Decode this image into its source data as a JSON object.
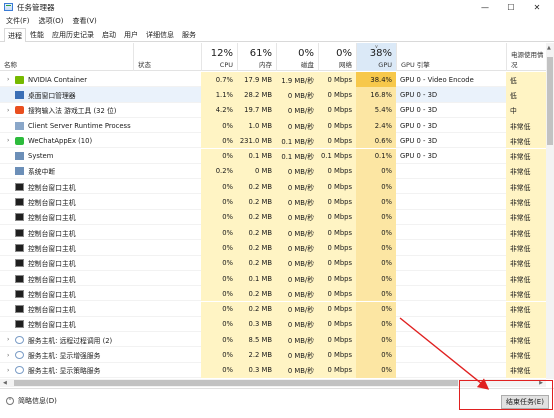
{
  "window": {
    "title": "任务管理器",
    "controls": [
      "—",
      "☐",
      "✕"
    ]
  },
  "menu": [
    "文件(F)",
    "选项(O)",
    "查看(V)"
  ],
  "tabs": [
    "进程",
    "性能",
    "应用历史记录",
    "启动",
    "用户",
    "详细信息",
    "服务"
  ],
  "active_tab": 0,
  "columns": {
    "name": "名称",
    "status": "状态",
    "cpu": {
      "pct": "12%",
      "label": "CPU"
    },
    "memory": {
      "pct": "61%",
      "label": "内存"
    },
    "disk": {
      "pct": "0%",
      "label": "磁盘"
    },
    "network": {
      "pct": "0%",
      "label": "网络"
    },
    "gpu": {
      "pct": "38%",
      "label": "GPU",
      "sort": "∨"
    },
    "gpu_engine": "GPU 引擎",
    "power": "电源使用情况"
  },
  "processes": [
    {
      "expand": "›",
      "icon": "nvidia-icon",
      "name": "NVIDIA Container",
      "cpu": "0.7%",
      "mem": "17.9 MB",
      "disk": "1.9 MB/秒",
      "net": "0 Mbps",
      "gpu": "38.4%",
      "engine": "GPU 0 - Video Encode",
      "power": "低"
    },
    {
      "expand": "",
      "icon": "dwm-icon",
      "name": "桌面窗口管理器",
      "cpu": "1.1%",
      "mem": "28.2 MB",
      "disk": "0 MB/秒",
      "net": "0 Mbps",
      "gpu": "16.8%",
      "engine": "GPU 0 - 3D",
      "power": "低",
      "selected": true
    },
    {
      "expand": "›",
      "icon": "sogou-icon",
      "name": "搜狗输入法 游戏工具 (32 位)",
      "cpu": "4.2%",
      "mem": "19.7 MB",
      "disk": "0 MB/秒",
      "net": "0 Mbps",
      "gpu": "5.4%",
      "engine": "GPU 0 - 3D",
      "power": "中"
    },
    {
      "expand": "",
      "icon": "csrss-icon",
      "name": "Client Server Runtime Process",
      "cpu": "0%",
      "mem": "1.0 MB",
      "disk": "0 MB/秒",
      "net": "0 Mbps",
      "gpu": "2.4%",
      "engine": "GPU 0 - 3D",
      "power": "非常低"
    },
    {
      "expand": "›",
      "icon": "wechat-icon",
      "name": "WeChatAppEx (10)",
      "cpu": "0%",
      "mem": "231.0 MB",
      "disk": "0.1 MB/秒",
      "net": "0 Mbps",
      "gpu": "0.6%",
      "engine": "GPU 0 - 3D",
      "power": "非常低"
    },
    {
      "expand": "",
      "icon": "system-icon",
      "name": "System",
      "cpu": "0%",
      "mem": "0.1 MB",
      "disk": "0.1 MB/秒",
      "net": "0.1 Mbps",
      "gpu": "0.1%",
      "engine": "GPU 0 - 3D",
      "power": "非常低"
    },
    {
      "expand": "",
      "icon": "interrupt-icon",
      "name": "系统中断",
      "cpu": "0.2%",
      "mem": "0 MB",
      "disk": "0 MB/秒",
      "net": "0 Mbps",
      "gpu": "0%",
      "engine": "",
      "power": "非常低"
    },
    {
      "expand": "",
      "icon": "console-icon",
      "name": "控制台窗口主机",
      "cpu": "0%",
      "mem": "0.2 MB",
      "disk": "0 MB/秒",
      "net": "0 Mbps",
      "gpu": "0%",
      "engine": "",
      "power": "非常低"
    },
    {
      "expand": "",
      "icon": "console-icon",
      "name": "控制台窗口主机",
      "cpu": "0%",
      "mem": "0.2 MB",
      "disk": "0 MB/秒",
      "net": "0 Mbps",
      "gpu": "0%",
      "engine": "",
      "power": "非常低"
    },
    {
      "expand": "",
      "icon": "console-icon",
      "name": "控制台窗口主机",
      "cpu": "0%",
      "mem": "0.2 MB",
      "disk": "0 MB/秒",
      "net": "0 Mbps",
      "gpu": "0%",
      "engine": "",
      "power": "非常低"
    },
    {
      "expand": "",
      "icon": "console-icon",
      "name": "控制台窗口主机",
      "cpu": "0%",
      "mem": "0.2 MB",
      "disk": "0 MB/秒",
      "net": "0 Mbps",
      "gpu": "0%",
      "engine": "",
      "power": "非常低"
    },
    {
      "expand": "",
      "icon": "console-icon",
      "name": "控制台窗口主机",
      "cpu": "0%",
      "mem": "0.2 MB",
      "disk": "0 MB/秒",
      "net": "0 Mbps",
      "gpu": "0%",
      "engine": "",
      "power": "非常低"
    },
    {
      "expand": "",
      "icon": "console-icon",
      "name": "控制台窗口主机",
      "cpu": "0%",
      "mem": "0.2 MB",
      "disk": "0 MB/秒",
      "net": "0 Mbps",
      "gpu": "0%",
      "engine": "",
      "power": "非常低"
    },
    {
      "expand": "",
      "icon": "console-icon",
      "name": "控制台窗口主机",
      "cpu": "0%",
      "mem": "0.1 MB",
      "disk": "0 MB/秒",
      "net": "0 Mbps",
      "gpu": "0%",
      "engine": "",
      "power": "非常低"
    },
    {
      "expand": "",
      "icon": "console-icon",
      "name": "控制台窗口主机",
      "cpu": "0%",
      "mem": "0.2 MB",
      "disk": "0 MB/秒",
      "net": "0 Mbps",
      "gpu": "0%",
      "engine": "",
      "power": "非常低"
    },
    {
      "expand": "",
      "icon": "console-icon",
      "name": "控制台窗口主机",
      "cpu": "0%",
      "mem": "0.2 MB",
      "disk": "0 MB/秒",
      "net": "0 Mbps",
      "gpu": "0%",
      "engine": "",
      "power": "非常低"
    },
    {
      "expand": "",
      "icon": "console-icon",
      "name": "控制台窗口主机",
      "cpu": "0%",
      "mem": "0.3 MB",
      "disk": "0 MB/秒",
      "net": "0 Mbps",
      "gpu": "0%",
      "engine": "",
      "power": "非常低"
    },
    {
      "expand": "›",
      "icon": "service-icon",
      "name": "服务主机: 远程过程调用 (2)",
      "cpu": "0%",
      "mem": "8.5 MB",
      "disk": "0 MB/秒",
      "net": "0 Mbps",
      "gpu": "0%",
      "engine": "",
      "power": "非常低"
    },
    {
      "expand": "›",
      "icon": "service-icon",
      "name": "服务主机: 显示增强服务",
      "cpu": "0%",
      "mem": "2.2 MB",
      "disk": "0 MB/秒",
      "net": "0 Mbps",
      "gpu": "0%",
      "engine": "",
      "power": "非常低"
    },
    {
      "expand": "›",
      "icon": "service-icon",
      "name": "服务主机: 显示策略服务",
      "cpu": "0%",
      "mem": "0.3 MB",
      "disk": "0 MB/秒",
      "net": "0 Mbps",
      "gpu": "0%",
      "engine": "",
      "power": "非常低"
    }
  ],
  "footer": {
    "summary": "简略信息(D)",
    "end_task": "结束任务(E)"
  },
  "colors": {
    "accent_highlight": "#e02020",
    "gpu_hot": "#f7c84b",
    "cpu_bg": "#fff4c4"
  }
}
